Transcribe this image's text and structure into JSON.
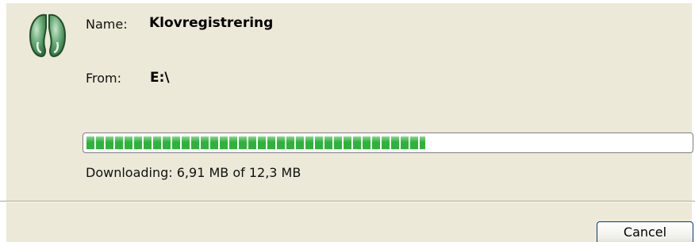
{
  "dialog": {
    "name_label": "Name:",
    "name_value": "Klovregistrering",
    "from_label": "From:",
    "from_value": "E:\\",
    "icon": "hoof-print-icon",
    "progress_fraction": 0.5618,
    "status_text": "Downloading: 6,91 MB of 12,3 MB",
    "cancel_label": "Cancel",
    "colors": {
      "progress_fill": "#2eb33a",
      "background": "#ece9d8"
    }
  }
}
